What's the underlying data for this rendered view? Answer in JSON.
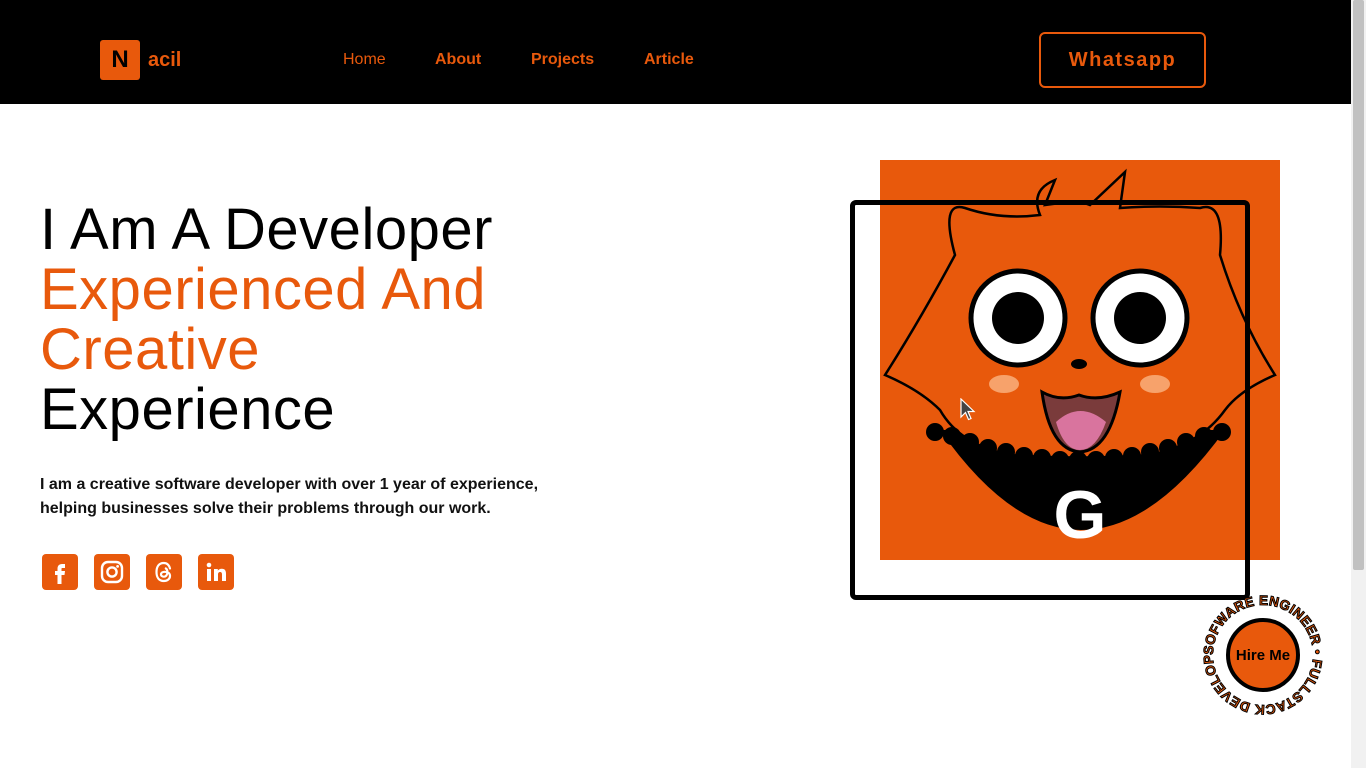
{
  "header": {
    "logo_letter": "N",
    "logo_text": "acil",
    "nav": [
      {
        "label": "Home"
      },
      {
        "label": "About"
      },
      {
        "label": "Projects"
      },
      {
        "label": "Article"
      }
    ],
    "cta_label": "Whatsapp"
  },
  "hero": {
    "title_line1": "I Am A Developer",
    "title_line2": "Experienced And",
    "title_line3": "Creative",
    "title_line4": "Experience",
    "description": "I am a creative software developer with over 1 year of experience, helping businesses solve their problems through our work."
  },
  "socials": [
    {
      "icon": "facebook-icon"
    },
    {
      "icon": "instagram-icon"
    },
    {
      "icon": "threads-icon"
    },
    {
      "icon": "linkedin-icon"
    }
  ],
  "avatar": {
    "shirt_logo": "G"
  },
  "badge": {
    "button_label": "Hire Me",
    "ring_text": "SOFWARE ENGINEER • FULLSTACK DEVELOPER •"
  },
  "colors": {
    "accent": "#e8590c",
    "background": "#ffffff",
    "header_bg": "#000000"
  }
}
